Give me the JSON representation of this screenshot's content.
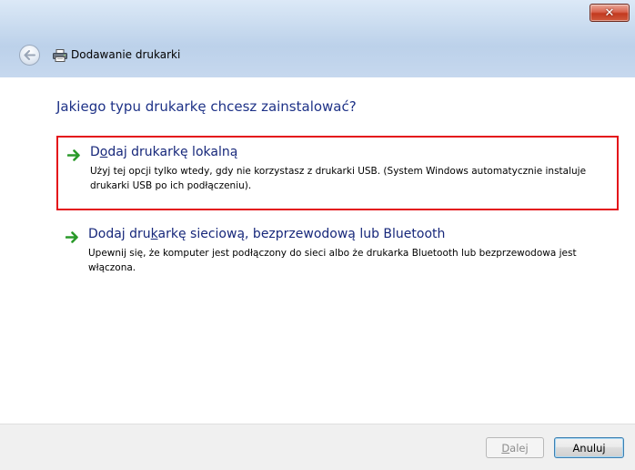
{
  "window": {
    "title": "Dodawanie drukarki",
    "close_glyph": "✕"
  },
  "content": {
    "heading": "Jakiego typu drukarkę chcesz zainstalować?",
    "options": [
      {
        "title_pre": "D",
        "title_key": "o",
        "title_post": "daj drukarkę lokalną",
        "description": "Użyj tej opcji tylko wtedy, gdy nie korzystasz z drukarki USB. (System Windows automatycznie instaluje drukarki USB po ich podłączeniu).",
        "selected": true,
        "icon": "green-arrow-icon"
      },
      {
        "title_pre": "Dodaj dru",
        "title_key": "k",
        "title_post": "arkę sieciową, bezprzewodową lub Bluetooth",
        "description": "Upewnij się, że komputer jest podłączony do sieci albo że drukarka Bluetooth lub bezprzewodowa jest włączona.",
        "selected": false,
        "icon": "green-arrow-icon"
      }
    ]
  },
  "footer": {
    "next_key": "D",
    "next_rest": "alej",
    "cancel_label": "Anuluj",
    "next_enabled": false
  },
  "colors": {
    "heading": "#1e3287",
    "option_title": "#16277a",
    "selection_border": "#e4131a",
    "arrow_green": "#2a9a2a"
  }
}
